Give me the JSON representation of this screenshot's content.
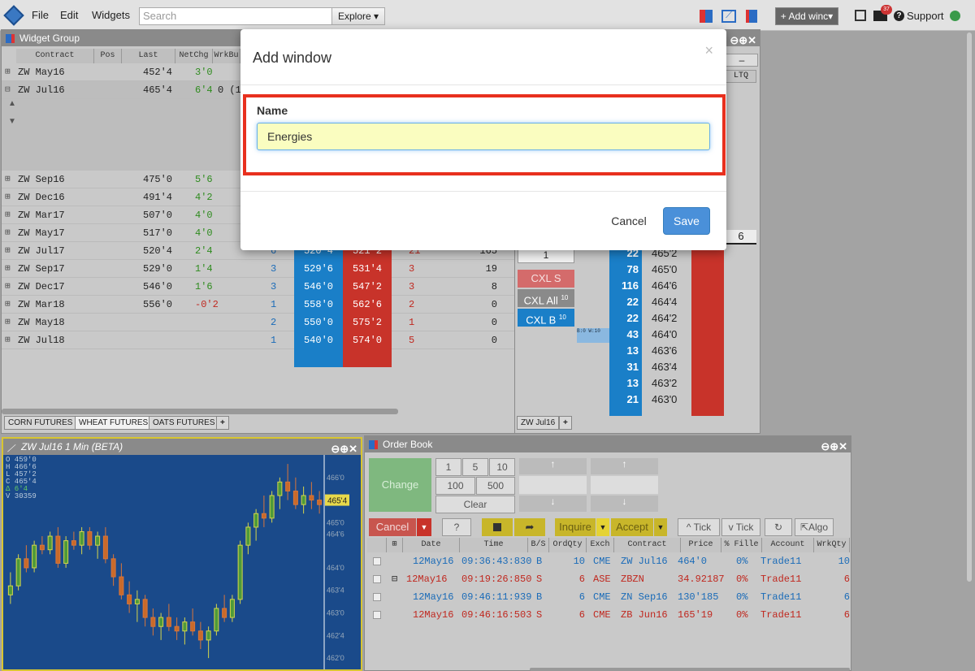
{
  "topbar": {
    "menu": [
      "File",
      "Edit",
      "Widgets"
    ],
    "search_placeholder": "Search",
    "explore_label": "Explore",
    "add_window_label": "+ Add winc",
    "mail_count": "37",
    "support_label": "Support"
  },
  "widget_group": {
    "title": "Widget Group",
    "columns": [
      "Contract",
      "Pos",
      "Last",
      "NetChg",
      "WrkBu"
    ],
    "rows": [
      {
        "contract": "ZW May16",
        "last": "452'4",
        "chg": "3'0"
      },
      {
        "contract": "ZW Jul16",
        "last": "465'4",
        "chg": "6'4",
        "extra": "0 (1"
      },
      {
        "contract": "ZW Sep16",
        "last": "475'0",
        "chg": "5'6"
      },
      {
        "contract": "ZW Dec16",
        "last": "491'4",
        "chg": "4'2"
      },
      {
        "contract": "ZW Mar17",
        "last": "507'0",
        "chg": "4'0"
      },
      {
        "contract": "ZW May17",
        "last": "517'0",
        "chg": "4'0"
      },
      {
        "contract": "ZW Jul17",
        "last": "520'4",
        "chg": "2'4",
        "bidqty": "6",
        "bid": "520'4",
        "ask": "521'2",
        "askqty": "21",
        "vol": "165"
      },
      {
        "contract": "ZW Sep17",
        "last": "529'0",
        "chg": "1'4",
        "bidqty": "3",
        "bid": "529'6",
        "ask": "531'4",
        "askqty": "3",
        "vol": "19"
      },
      {
        "contract": "ZW Dec17",
        "last": "546'0",
        "chg": "1'6",
        "bidqty": "3",
        "bid": "546'0",
        "ask": "547'2",
        "askqty": "3",
        "vol": "8"
      },
      {
        "contract": "ZW Mar18",
        "last": "556'0",
        "chg": "-0'2",
        "bidqty": "1",
        "bid": "558'0",
        "ask": "562'6",
        "askqty": "2",
        "vol": "0"
      },
      {
        "contract": "ZW May18",
        "last": "",
        "chg": "",
        "bidqty": "2",
        "bid": "550'0",
        "ask": "575'2",
        "askqty": "1",
        "vol": "0"
      },
      {
        "contract": "ZW Jul18",
        "last": "",
        "chg": "",
        "bidqty": "1",
        "bid": "540'0",
        "ask": "574'0",
        "askqty": "5",
        "vol": "0"
      }
    ],
    "tabs": [
      "CORN FUTURES",
      "WHEAT FUTURES",
      "OATS FUTURES"
    ]
  },
  "dom": {
    "ltq_label": "LTQ",
    "ltq_value": "6",
    "qty_value": "1",
    "cxl_s": "CXL S",
    "cxl_all": "CXL All",
    "cxl_all_count": "10",
    "cxl_b": "CXL B",
    "cxl_b_count": "10",
    "bw_label": "B:0 W:10",
    "tab": "ZW Jul16",
    "ladder": [
      {
        "qty": "22",
        "price": "465'2"
      },
      {
        "qty": "78",
        "price": "465'0"
      },
      {
        "qty": "116",
        "price": "464'6"
      },
      {
        "qty": "22",
        "price": "464'4"
      },
      {
        "qty": "22",
        "price": "464'2"
      },
      {
        "qty": "43",
        "price": "464'0"
      },
      {
        "qty": "13",
        "price": "463'6"
      },
      {
        "qty": "31",
        "price": "463'4"
      },
      {
        "qty": "13",
        "price": "463'2"
      },
      {
        "qty": "21",
        "price": "463'0"
      }
    ]
  },
  "chart": {
    "title": "ZW Jul16 1 Min (BETA)",
    "ohlc": [
      "O 459'0",
      "H 466'6",
      "L 457'2",
      "C 465'4",
      "Δ 6'4",
      "V 30359"
    ],
    "last_price": "465'4",
    "y_ticks": [
      "466'0",
      "465'0",
      "464'6",
      "464'0",
      "463'4",
      "463'0",
      "462'4",
      "462'0"
    ]
  },
  "chart_data": {
    "type": "candlestick",
    "ylim": [
      461.75,
      466.5
    ],
    "candles": [
      [
        463.4,
        463.9,
        463.2,
        463.6
      ],
      [
        463.6,
        464.3,
        463.5,
        464.2
      ],
      [
        464.2,
        464.5,
        463.9,
        464.0
      ],
      [
        464.0,
        464.6,
        463.9,
        464.5
      ],
      [
        464.5,
        464.7,
        464.3,
        464.4
      ],
      [
        464.4,
        464.8,
        464.3,
        464.7
      ],
      [
        464.7,
        464.9,
        464.0,
        464.1
      ],
      [
        464.1,
        464.7,
        464.0,
        464.6
      ],
      [
        464.6,
        464.8,
        464.4,
        464.5
      ],
      [
        464.5,
        464.9,
        464.3,
        464.8
      ],
      [
        464.8,
        464.9,
        464.4,
        464.5
      ],
      [
        464.5,
        464.8,
        464.2,
        464.7
      ],
      [
        464.7,
        464.9,
        464.1,
        464.2
      ],
      [
        464.2,
        464.3,
        463.6,
        463.8
      ],
      [
        463.8,
        464.1,
        463.3,
        463.4
      ],
      [
        463.4,
        463.7,
        463.0,
        463.2
      ],
      [
        463.2,
        463.5,
        462.8,
        463.3
      ],
      [
        463.3,
        463.4,
        462.7,
        462.9
      ],
      [
        462.9,
        463.1,
        462.5,
        462.7
      ],
      [
        462.7,
        463.0,
        462.4,
        462.9
      ],
      [
        462.9,
        463.2,
        462.6,
        462.7
      ],
      [
        462.7,
        462.9,
        462.4,
        462.6
      ],
      [
        462.6,
        462.9,
        462.3,
        462.8
      ],
      [
        462.8,
        463.1,
        462.5,
        462.6
      ],
      [
        462.6,
        462.8,
        462.2,
        462.4
      ],
      [
        462.4,
        462.7,
        462.0,
        462.6
      ],
      [
        462.6,
        463.2,
        462.5,
        463.1
      ],
      [
        463.1,
        463.4,
        462.8,
        462.9
      ],
      [
        462.9,
        463.4,
        462.8,
        463.3
      ],
      [
        463.3,
        464.6,
        463.2,
        464.5
      ],
      [
        464.5,
        465.0,
        464.3,
        464.9
      ],
      [
        464.9,
        465.3,
        464.6,
        465.2
      ],
      [
        465.2,
        465.6,
        464.9,
        465.1
      ],
      [
        465.1,
        465.7,
        465.0,
        465.6
      ],
      [
        465.6,
        466.0,
        465.3,
        465.9
      ],
      [
        465.9,
        466.3,
        465.5,
        465.7
      ],
      [
        465.7,
        466.0,
        465.3,
        465.4
      ],
      [
        465.4,
        465.8,
        465.2,
        465.6
      ],
      [
        465.6,
        465.9,
        465.3,
        465.5
      ],
      [
        465.5,
        465.7,
        465.2,
        465.4
      ]
    ]
  },
  "order_book": {
    "title": "Order Book",
    "change_label": "Change",
    "qty_buttons": [
      "1",
      "5",
      "10",
      "100",
      "500"
    ],
    "clear_label": "Clear",
    "cancel_label": "Cancel",
    "help_label": "?",
    "inquire_label": "Inquire",
    "accept_label": "Accept",
    "tick_up_label": "Tick",
    "tick_down_label": "Tick",
    "algo_label": "Algo",
    "columns": [
      "Date",
      "Time",
      "B/S",
      "OrdQty",
      "Exch",
      "Contract",
      "Price",
      "% Fille",
      "Account",
      "WrkQty"
    ],
    "rows": [
      {
        "date": "12May16",
        "time": "09:36:43:830",
        "bs": "B",
        "qty": "10",
        "exch": "CME",
        "contract": "ZW Jul16",
        "price": "464'0",
        "fill": "0%",
        "account": "Trade11",
        "wrk": "10",
        "color": "blue"
      },
      {
        "date": "12May16",
        "time": "09:19:26:850",
        "bs": "S",
        "qty": "6",
        "exch": "ASE",
        "contract": "ZBZN",
        "price": "34.92187",
        "fill": "0%",
        "account": "Trade11",
        "wrk": "6",
        "color": "red"
      },
      {
        "date": "12May16",
        "time": "09:46:11:939",
        "bs": "B",
        "qty": "6",
        "exch": "CME",
        "contract": "ZN Sep16",
        "price": "130'185",
        "fill": "0%",
        "account": "Trade11",
        "wrk": "6",
        "color": "blue"
      },
      {
        "date": "12May16",
        "time": "09:46:16:503",
        "bs": "S",
        "qty": "6",
        "exch": "CME",
        "contract": "ZB Jun16",
        "price": "165'19",
        "fill": "0%",
        "account": "Trade11",
        "wrk": "6",
        "color": "red"
      }
    ]
  },
  "modal": {
    "title": "Add window",
    "close": "×",
    "field_label": "Name",
    "field_value": "Energies",
    "cancel_label": "Cancel",
    "save_label": "Save"
  }
}
